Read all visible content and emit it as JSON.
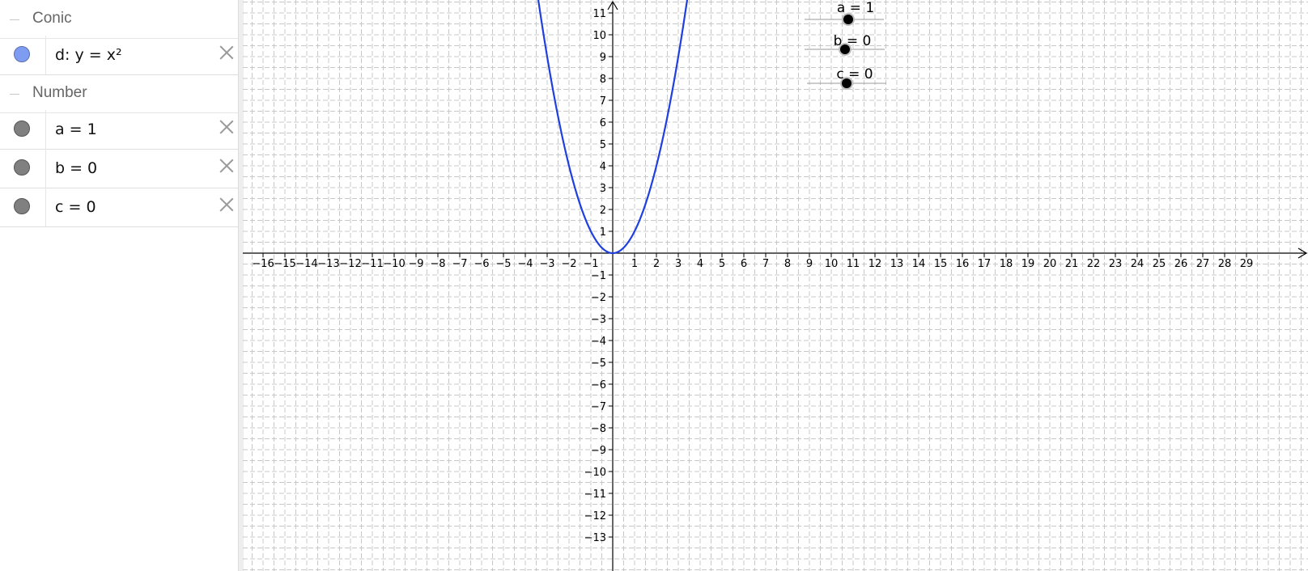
{
  "algebra": {
    "categories": [
      {
        "label": "Conic",
        "items": [
          {
            "expr": "d: y = x²",
            "color": "#7d9cf2"
          }
        ]
      },
      {
        "label": "Number",
        "items": [
          {
            "expr": "a = 1",
            "color": "#808080"
          },
          {
            "expr": "b = 0",
            "color": "#808080"
          },
          {
            "expr": "c = 0",
            "color": "#808080"
          }
        ]
      }
    ]
  },
  "graphics": {
    "x_ticks": [
      -16,
      -15,
      -14,
      -13,
      -12,
      -11,
      -10,
      -9,
      -8,
      -7,
      -6,
      -5,
      -4,
      -3,
      -2,
      -1,
      1,
      2,
      3,
      4,
      5,
      6,
      7,
      8,
      9,
      10,
      11,
      12,
      13,
      14,
      15,
      16,
      17,
      18,
      19,
      20,
      21,
      22,
      23,
      24,
      25,
      26,
      27,
      28,
      29
    ],
    "y_ticks": [
      11,
      10,
      9,
      8,
      7,
      6,
      5,
      4,
      3,
      2,
      1,
      -1,
      -2,
      -3,
      -4,
      -5,
      -6,
      -7,
      -8,
      -9,
      -10,
      -11,
      -12,
      -13
    ],
    "curve": {
      "equation": "y = x²",
      "color": "#1f3fe0"
    },
    "axis_color": "#000000",
    "grid_color": "#c8c8c8"
  },
  "sliders": [
    {
      "label": "a = 1",
      "value": 1
    },
    {
      "label": "b = 0",
      "value": 0
    },
    {
      "label": "c = 0",
      "value": 0
    }
  ]
}
